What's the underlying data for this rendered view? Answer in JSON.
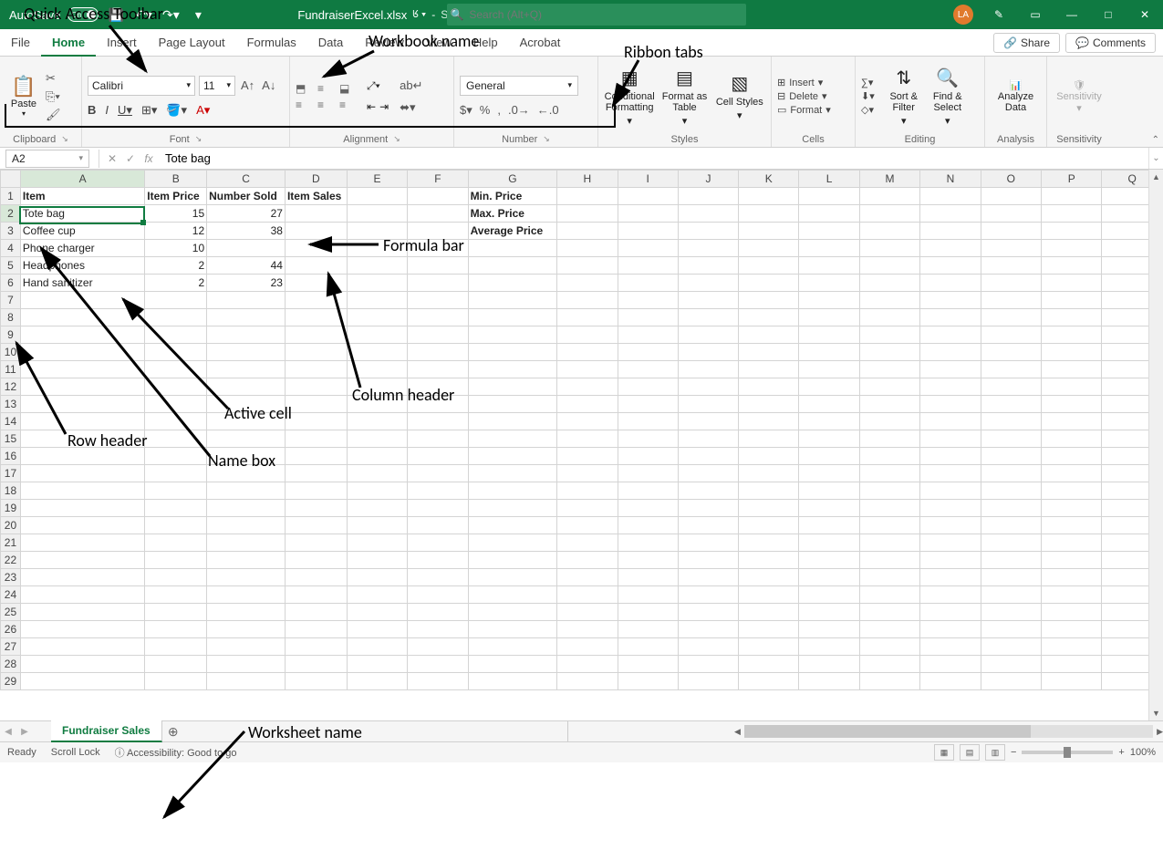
{
  "titlebar": {
    "autosave_label": "AutoSave",
    "autosave_state": "On",
    "filename": "FundraiserExcel.xlsx",
    "saved_status": "Saved",
    "search_placeholder": "Search (Alt+Q)",
    "avatar_initials": "LA"
  },
  "tabs": {
    "items": [
      "File",
      "Home",
      "Insert",
      "Page Layout",
      "Formulas",
      "Data",
      "Review",
      "View",
      "Help",
      "Acrobat"
    ],
    "active": "Home",
    "share_label": "Share",
    "comments_label": "Comments"
  },
  "ribbon": {
    "clipboard": {
      "paste_label": "Paste",
      "group_label": "Clipboard"
    },
    "font": {
      "name": "Calibri",
      "size": "11",
      "group_label": "Font"
    },
    "alignment": {
      "group_label": "Alignment",
      "wrap_label": "ab"
    },
    "number": {
      "format": "General",
      "group_label": "Number"
    },
    "styles": {
      "conditional_label": "Conditional Formatting",
      "format_as_label": "Format as Table",
      "cell_styles_label": "Cell Styles",
      "group_label": "Styles"
    },
    "cells": {
      "insert_label": "Insert",
      "delete_label": "Delete",
      "format_label": "Format",
      "group_label": "Cells"
    },
    "editing": {
      "sort_label": "Sort & Filter",
      "find_label": "Find & Select",
      "group_label": "Editing"
    },
    "analysis": {
      "analyze_label": "Analyze Data",
      "group_label": "Analysis"
    },
    "sensitivity": {
      "label": "Sensitivity",
      "group_label": "Sensitivity"
    }
  },
  "formula_bar": {
    "name_box": "A2",
    "formula": "Tote bag"
  },
  "grid": {
    "columns": [
      "A",
      "B",
      "C",
      "D",
      "E",
      "F",
      "G",
      "H",
      "I",
      "J",
      "K",
      "L",
      "M",
      "N",
      "O",
      "P",
      "Q"
    ],
    "row_count": 29,
    "active_col": 0,
    "active_row": 1,
    "headers_row1": {
      "A": "Item",
      "B": "Item Price",
      "C": "Number Sold",
      "D": "Item Sales"
    },
    "data": [
      {
        "A": "Tote bag",
        "B": "15",
        "C": "27"
      },
      {
        "A": "Coffee cup",
        "B": "12",
        "C": "38"
      },
      {
        "A": "Phone charger",
        "B": "10",
        "C": ""
      },
      {
        "A": "Headphones",
        "B": "2",
        "C": "44"
      },
      {
        "A": "Hand sanitizer",
        "B": "2",
        "C": "23"
      }
    ],
    "side_labels": {
      "G1": "Min. Price",
      "G2": "Max. Price",
      "G3": "Average Price"
    }
  },
  "sheet_tabs": {
    "active": "Fundraiser Sales"
  },
  "statusbar": {
    "ready": "Ready",
    "scroll_lock": "Scroll Lock",
    "accessibility": "Accessibility: Good to go",
    "zoom": "100%"
  },
  "annotations": {
    "qat": "Quick Access Toolbar",
    "workbook": "Workbook name",
    "ribbon_tabs": "Ribbon tabs",
    "formula_bar": "Formula bar",
    "column_header": "Column header",
    "active_cell": "Active cell",
    "name_box": "Name box",
    "row_header": "Row header",
    "worksheet_name": "Worksheet name"
  }
}
